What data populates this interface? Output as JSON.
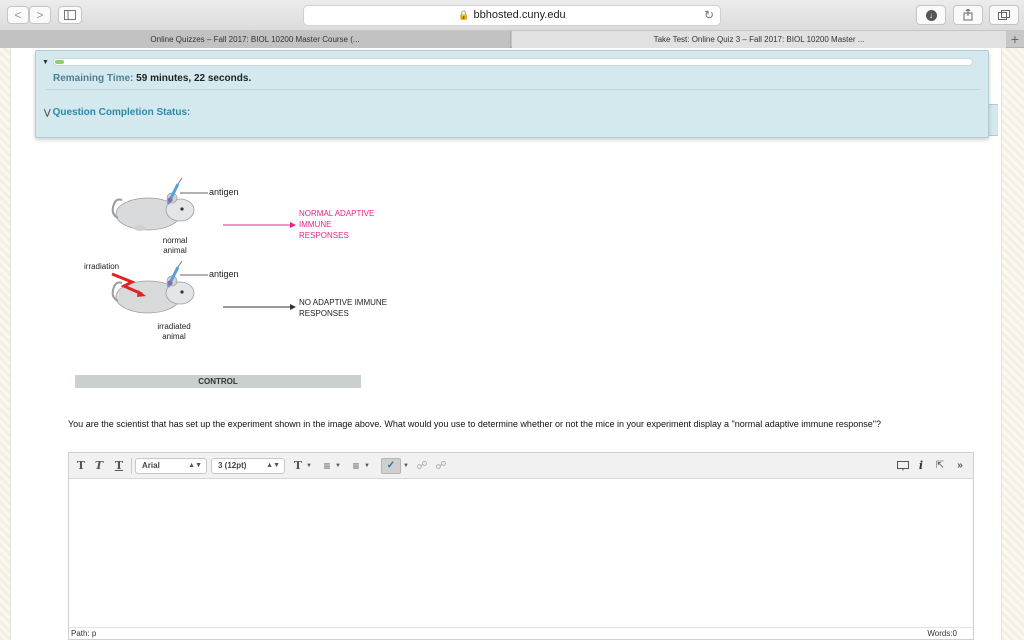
{
  "browser": {
    "url": "bbhosted.cuny.edu",
    "back": "<",
    "forward": ">",
    "tabs": [
      {
        "title": "Online Quizzes – Fall 2017: BIOL 10200 Master Course (..."
      },
      {
        "title": "Take Test: Online Quiz 3 – Fall 2017: BIOL 10200 Master ..."
      }
    ],
    "new_tab": "+"
  },
  "timer": {
    "label": "Remaining Time:",
    "value": "59 minutes, 22 seconds.",
    "progress_fraction": 0.01,
    "progress_color": "#8fcf6b",
    "completion_status": "Question Completion Status:"
  },
  "figure": {
    "antigen_top": "antigen",
    "normal_animal_1": "normal",
    "normal_animal_2": "animal",
    "normal_response_1": "NORMAL ADAPTIVE",
    "normal_response_2": "IMMUNE",
    "normal_response_3": "RESPONSES",
    "irradiation": "irradiation",
    "antigen_bottom": "antigen",
    "irradiated_animal_1": "irradiated",
    "irradiated_animal_2": "animal",
    "no_response_1": "NO ADAPTIVE IMMUNE",
    "no_response_2": "RESPONSES",
    "caption": "CONTROL",
    "highlight_color": "#e8238a"
  },
  "question": {
    "text": "You are the scientist that has set up the experiment shown in the image above. What would you use to determine whether or not the mice in your experiment display a \"normal adaptive immune response\"?"
  },
  "editor": {
    "font_family": "Arial",
    "font_size": "3 (12pt)",
    "path": "Path: p",
    "words": "Words:0"
  }
}
